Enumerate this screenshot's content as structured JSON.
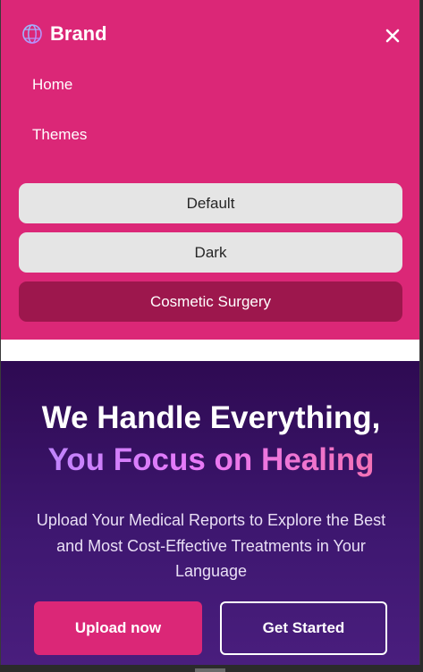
{
  "brand": {
    "name": "Brand",
    "icon": "globe-icon"
  },
  "nav": {
    "close_icon": "close-icon",
    "links": [
      {
        "label": "Home"
      },
      {
        "label": "Themes"
      }
    ],
    "themes": [
      {
        "label": "Default",
        "active": false
      },
      {
        "label": "Dark",
        "active": false
      },
      {
        "label": "Cosmetic Surgery",
        "active": true
      }
    ]
  },
  "hero": {
    "headline_line1": "We Handle Everything,",
    "headline_line2": "You Focus on Healing",
    "subtitle": "Upload Your Medical Reports to Explore the Best and Most Cost-Effective Treatments in Your Language",
    "primary_button": "Upload now",
    "secondary_button": "Get Started"
  },
  "colors": {
    "nav_background": "#db2777",
    "active_theme": "#9d174d",
    "theme_button": "#e5e5e5",
    "hero_top": "#2e0a52",
    "hero_bottom": "#4a1e7e",
    "accent_gradient": [
      "#c084fc",
      "#f472b6"
    ]
  }
}
